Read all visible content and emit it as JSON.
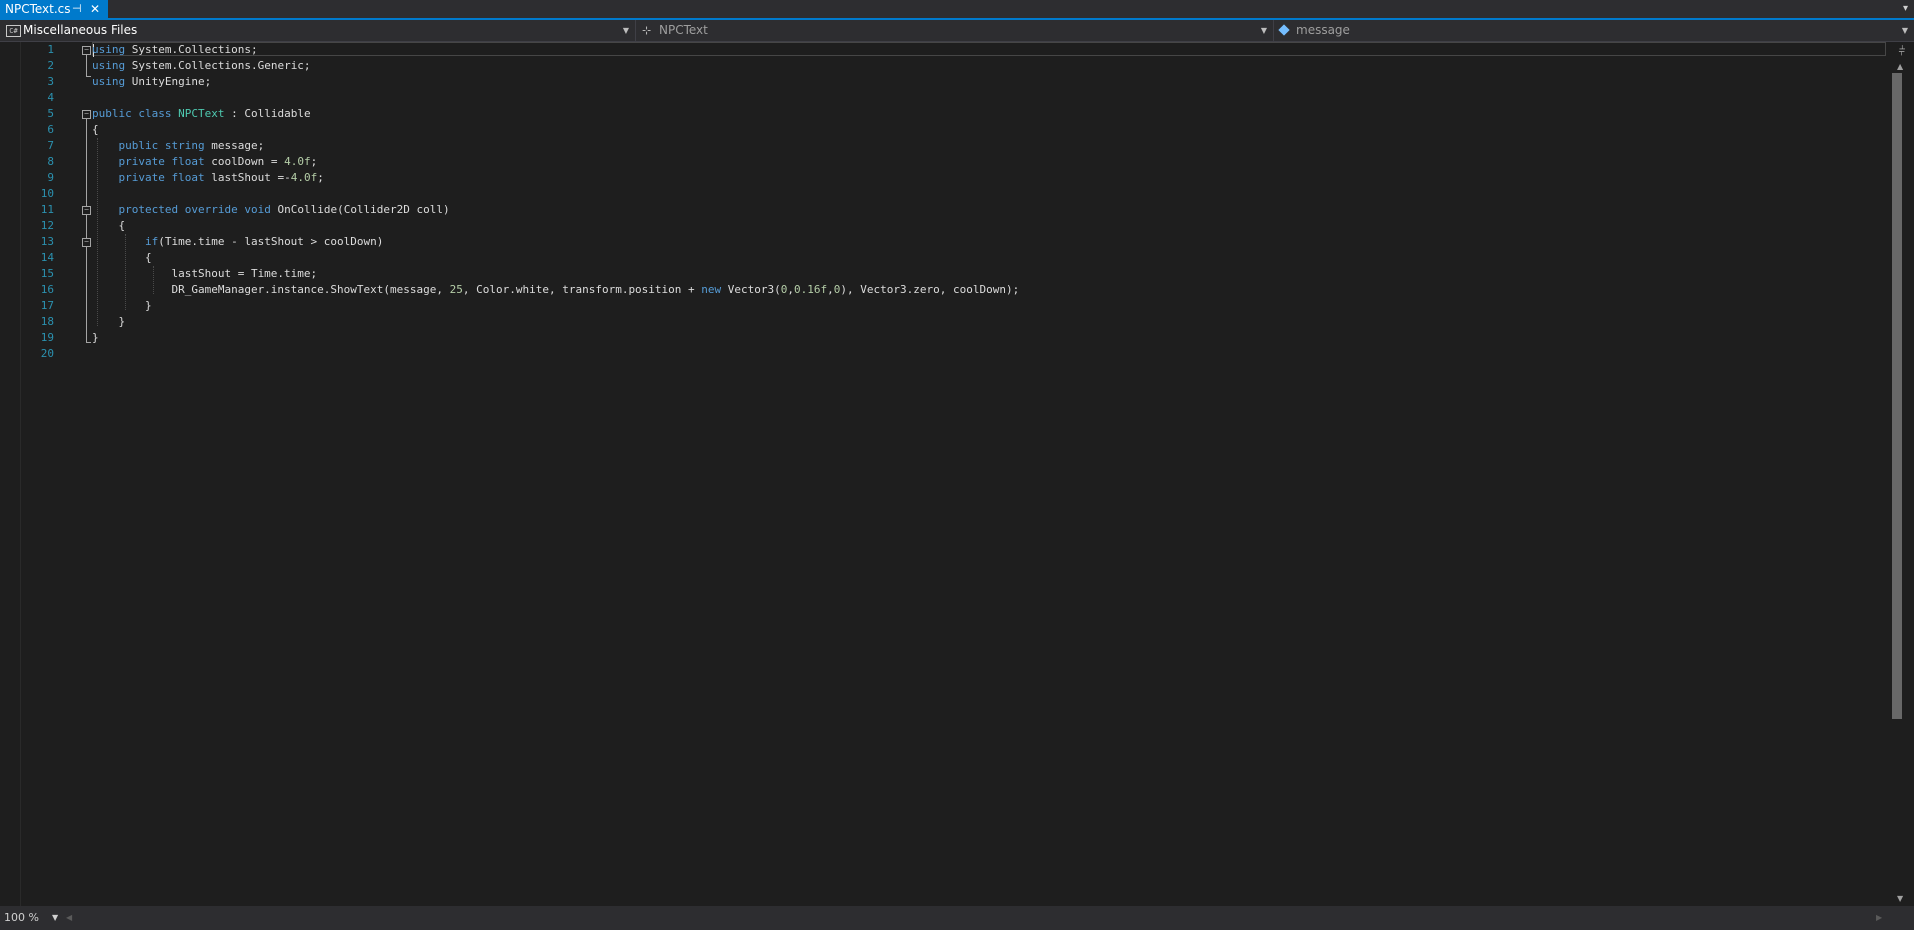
{
  "tab": {
    "label": "NPCText.cs",
    "pin_glyph": "⊣",
    "close_glyph": "✕"
  },
  "navbar": {
    "project": "Miscellaneous Files",
    "project_icon_text": "C#",
    "type": "NPCText",
    "member": "message"
  },
  "editor": {
    "line_numbers": [
      "1",
      "2",
      "3",
      "4",
      "5",
      "6",
      "7",
      "8",
      "9",
      "10",
      "11",
      "12",
      "13",
      "14",
      "15",
      "16",
      "17",
      "18",
      "19",
      "20"
    ],
    "lines": [
      "using System.Collections;",
      "using System.Collections.Generic;",
      "using UnityEngine;",
      "",
      "public class NPCText : Collidable",
      "{",
      "    public string message;",
      "    private float coolDown = 4.0f;",
      "    private float lastShout =-4.0f;",
      "",
      "    protected override void OnCollide(Collider2D coll)",
      "    {",
      "        if(Time.time - lastShout > coolDown)",
      "        {",
      "            lastShout = Time.time;",
      "            DR_GameManager.instance.ShowText(message, 25, Color.white, transform.position + new Vector3(0,0.16f,0), Vector3.zero, coolDown);",
      "        }",
      "    }",
      "}",
      ""
    ]
  },
  "statusbar": {
    "zoom": "100 %"
  },
  "icons": {
    "fold": "collapse-icon",
    "project": "csharp-project-icon",
    "class": "class-icon",
    "field": "field-icon"
  },
  "colors": {
    "keyword": "#569cd6",
    "type": "#4ec9b0",
    "number": "#b5cea8",
    "line_number": "#2b91af",
    "accent": "#007acc"
  }
}
